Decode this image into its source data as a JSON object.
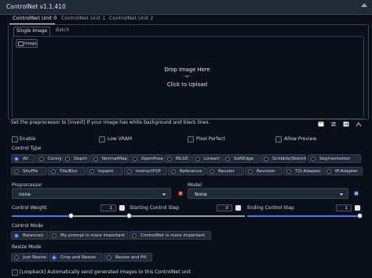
{
  "panel": {
    "title": "ControlNet v1.1.410"
  },
  "tabs": [
    "ControlNet Unit 0",
    "ControlNet Unit 1",
    "ControlNet Unit 2"
  ],
  "subtabs": [
    "Single Image",
    "Batch"
  ],
  "image": {
    "tag_label": "Image",
    "drop_line1": "Drop Image Here",
    "drop_line2": "- or -",
    "drop_line3": "Click to Upload"
  },
  "hint": "Set the preprocessor to [invert] If your image has white background and black lines.",
  "checkboxes": {
    "enable": "Enable",
    "low_vram": "Low VRAM",
    "pixel_perfect": "Pixel Perfect",
    "allow_preview": "Allow Preview"
  },
  "control_type": {
    "title": "Control Type",
    "options": [
      "All",
      "Canny",
      "Depth",
      "NormalMap",
      "OpenPose",
      "MLSD",
      "Lineart",
      "SoftEdge",
      "Scribble/Sketch",
      "Segmentation",
      "Shuffle",
      "Tile/Blur",
      "Inpaint",
      "InstructP2P",
      "Reference",
      "Recolor",
      "Revision",
      "T2I-Adapter",
      "IP-Adapter"
    ],
    "selected": "All"
  },
  "preprocessor": {
    "label": "Preprocessor",
    "value": "none"
  },
  "model": {
    "label": "Model",
    "value": "None"
  },
  "sliders": {
    "weight": {
      "label": "Control Weight",
      "value": "1",
      "fraction": 0.5
    },
    "start": {
      "label": "Starting Control Step",
      "value": "0",
      "fraction": 0.0
    },
    "end": {
      "label": "Ending Control Step",
      "value": "1",
      "fraction": 1.0
    }
  },
  "control_mode": {
    "title": "Control Mode",
    "options": [
      "Balanced",
      "My prompt is more important",
      "ControlNet is more important"
    ],
    "selected": "Balanced"
  },
  "resize_mode": {
    "title": "Resize Mode",
    "options": [
      "Just Resize",
      "Crop and Resize",
      "Resize and Fill"
    ],
    "selected": "Crop and Resize"
  },
  "loopback": "[Loopback] Automatically send generated images to this ControlNet unit",
  "colors": {
    "accent": "#2563eb",
    "slider_fill": "#3b82f6",
    "background": "#0b0f19",
    "panel": "#1f2937"
  },
  "icons": [
    "image-icon",
    "edit-icon",
    "swap-icon",
    "send-icon",
    "camera-icon",
    "fire-icon",
    "refresh-icon",
    "reset-icon",
    "collapse-icon"
  ]
}
